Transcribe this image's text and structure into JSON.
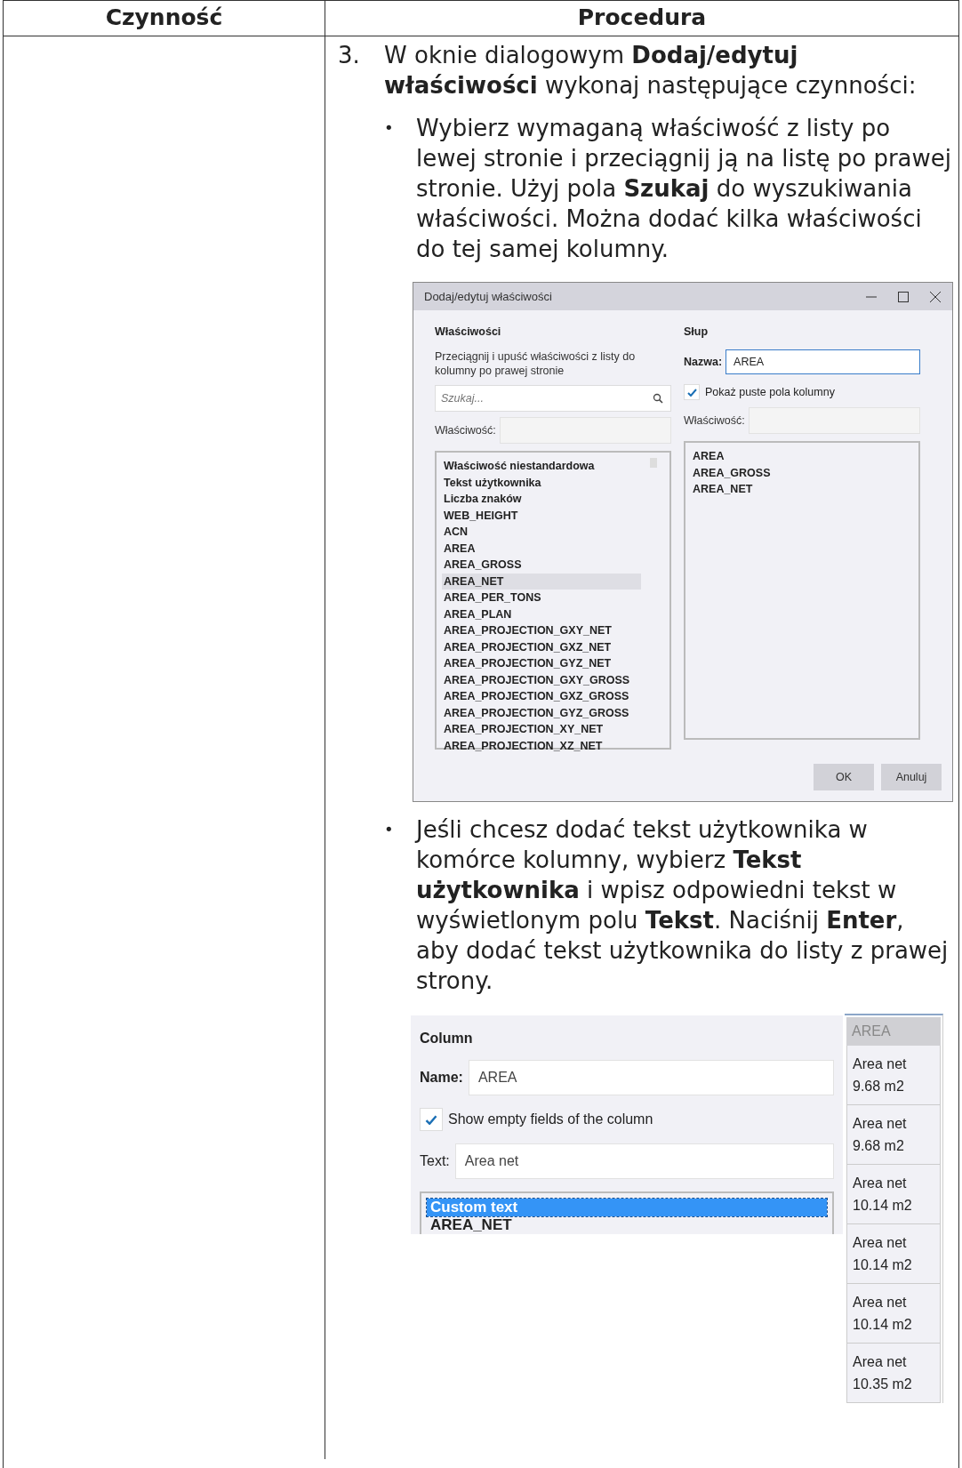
{
  "table": {
    "columns": [
      "Czynność",
      "Procedura"
    ],
    "step": {
      "number": "3.",
      "text": "W oknie dialogowym **Dodaj/edytuj właściwości** wykonaj następujące czynności:",
      "bullets": [
        {
          "marker": "•",
          "text": "Wybierz wymaganą właściwość z listy po lewej stronie i przeciągnij ją na listę po prawej stronie. Użyj pola **Szukaj** do wyszukiwania właściwości. Można dodać kilka właściwości do tej samej kolumny.",
          "kind": "dialog"
        },
        {
          "marker": "•",
          "text": "Jeśli chcesz dodać tekst użytkownika w komórce kolumny, wybierz **Tekst użytkownika** i wpisz odpowiedni tekst w wyświetlonym polu **Tekst**. Naciśnij **Enter**, aby dodać tekst użytkownika do listy z prawej strony.",
          "kind": "panel"
        }
      ]
    }
  },
  "dialog": {
    "title": "Dodaj/edytuj właściwości",
    "left": {
      "heading": "Właściwości",
      "hint": "Przeciągnij i upuść właściwości z listy do kolumny po prawej stronie",
      "search": {
        "placeholder": "Szukaj..."
      },
      "property_label": "Właściwość:",
      "items": [
        {
          "label": "Właściwość niestandardowa",
          "selected": false
        },
        {
          "label": "Tekst użytkownika",
          "selected": false
        },
        {
          "label": "Liczba znaków",
          "selected": false
        },
        {
          "label": "WEB_HEIGHT",
          "selected": false
        },
        {
          "label": "ACN",
          "selected": false
        },
        {
          "label": "AREA",
          "selected": false
        },
        {
          "label": "AREA_GROSS",
          "selected": false
        },
        {
          "label": "AREA_NET",
          "selected": true
        },
        {
          "label": "AREA_PER_TONS",
          "selected": false
        },
        {
          "label": "AREA_PLAN",
          "selected": false
        },
        {
          "label": "AREA_PROJECTION_GXY_NET",
          "selected": false
        },
        {
          "label": "AREA_PROJECTION_GXZ_NET",
          "selected": false
        },
        {
          "label": "AREA_PROJECTION_GYZ_NET",
          "selected": false
        },
        {
          "label": "AREA_PROJECTION_GXY_GROSS",
          "selected": false
        },
        {
          "label": "AREA_PROJECTION_GXZ_GROSS",
          "selected": false
        },
        {
          "label": "AREA_PROJECTION_GYZ_GROSS",
          "selected": false
        },
        {
          "label": "AREA_PROJECTION_XY_NET",
          "selected": false
        },
        {
          "label": "AREA_PROJECTION_XZ_NET",
          "selected": false
        }
      ]
    },
    "right": {
      "heading": "Słup",
      "name_label": "Nazwa:",
      "name_value": "AREA",
      "show_empty": {
        "label": "Pokaż puste pola kolumny",
        "checked": true
      },
      "property_label": "Właściwość:",
      "items": [
        {
          "label": "AREA",
          "selected": false
        },
        {
          "label": "AREA_GROSS",
          "selected": false
        },
        {
          "label": "AREA_NET",
          "selected": false
        }
      ]
    },
    "buttons": [
      "OK",
      "Anuluj"
    ]
  },
  "panel": {
    "heading": "Column",
    "name_label": "Name:",
    "name_value": "AREA",
    "show_empty": {
      "label": "Show empty fields of the column",
      "checked": true
    },
    "text_label": "Text:",
    "text_value": "Area net",
    "items": [
      {
        "label": "Custom text",
        "selected": true
      },
      {
        "label": "AREA_NET",
        "selected": false
      }
    ],
    "preview": {
      "header": "AREA",
      "cells": [
        "Area net\n9.68 m2",
        "Area net\n9.68 m2",
        "Area net\n10.14 m2",
        "Area net\n10.14 m2",
        "Area net\n10.14 m2",
        "Area net\n10.35 m2"
      ]
    }
  }
}
